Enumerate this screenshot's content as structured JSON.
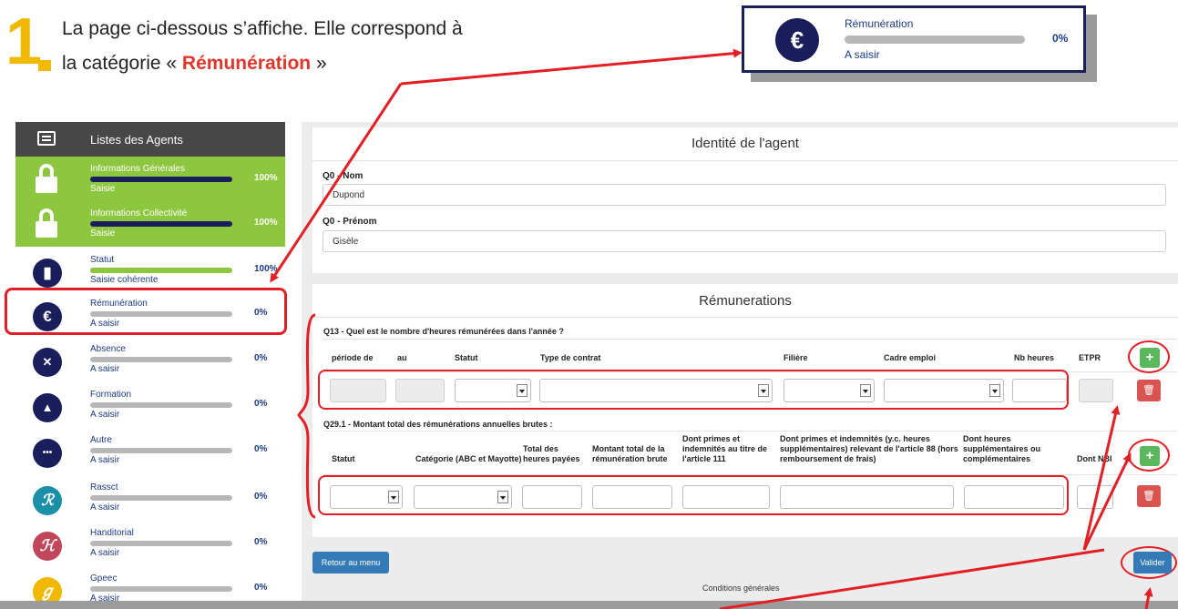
{
  "intro": {
    "step_number": "1",
    "line1": "La page ci-dessous s’affiche. Elle correspond à",
    "line2_prefix": "la catégorie « ",
    "line2_highlight": "Rémunération",
    "line2_suffix": " »"
  },
  "callout": {
    "icon_symbol": "€",
    "title": "Rémunération",
    "percent": "0%",
    "progress": 0,
    "status": "A saisir"
  },
  "sidebar": {
    "header_label": "Listes des Agents",
    "items": [
      {
        "name": "Informations Générales",
        "percent": "100%",
        "progress": 100,
        "status": "Saisie",
        "icon": "unlock-icon"
      },
      {
        "name": "Informations Collectivité",
        "percent": "100%",
        "progress": 100,
        "status": "Saisie",
        "icon": "unlock-icon"
      },
      {
        "name": "Statut",
        "percent": "100%",
        "progress": 100,
        "status": "Saisie cohérente",
        "icon": "briefcase-icon",
        "symbol": "▮"
      },
      {
        "name": "Rémunération",
        "percent": "0%",
        "progress": 0,
        "status": "A saisir",
        "icon": "euro-icon",
        "symbol": "€"
      },
      {
        "name": "Absence",
        "percent": "0%",
        "progress": 0,
        "status": "A saisir",
        "icon": "user-x-icon",
        "symbol": "✕"
      },
      {
        "name": "Formation",
        "percent": "0%",
        "progress": 0,
        "status": "A saisir",
        "icon": "graduation-cap-icon",
        "symbol": "▲"
      },
      {
        "name": "Autre",
        "percent": "0%",
        "progress": 0,
        "status": "A saisir",
        "icon": "ellipsis-icon",
        "symbol": "•••"
      },
      {
        "name": "Rassct",
        "percent": "0%",
        "progress": 0,
        "status": "A saisir",
        "icon": "letter-r-icon",
        "symbol": "ℛ"
      },
      {
        "name": "Handitorial",
        "percent": "0%",
        "progress": 0,
        "status": "A saisir",
        "icon": "letter-h-icon",
        "symbol": "ℋ"
      },
      {
        "name": "Gpeec",
        "percent": "0%",
        "progress": 0,
        "status": "A saisir",
        "icon": "letter-g-icon",
        "symbol": "ℊ"
      }
    ],
    "colors": {
      "dark_navy": "#1a1f5c",
      "green": "#8dc63f",
      "rassct": "#1b8fa8",
      "handitorial": "#c0475a",
      "gpeec": "#f0b800"
    }
  },
  "identity": {
    "title": "Identité de l'agent",
    "nom_label": "Q0 - Nom",
    "nom_value": "Dupond",
    "prenom_label": "Q0 - Prénom",
    "prenom_value": "Gisèle"
  },
  "remunerations": {
    "title": "Rémunerations",
    "q13_label": "Q13 - Quel est le nombre d'heures rémunérées dans l'année ?",
    "q13_headers": [
      "période de",
      "au",
      "Statut",
      "Type de contrat",
      "Filière",
      "Cadre emploi",
      "Nb heures",
      "ETPR"
    ],
    "q29_label": "Q29.1 - Montant total des rémunérations annuelles brutes :",
    "q29_headers": [
      "Statut",
      "Catégorie (ABC et Mayotte)",
      "Total des heures payées",
      "Montant total de la rémunération brute",
      "Dont primes et indemnités au titre de l'article 111",
      "Dont primes et indemnités (y.c. heures supplémentaires) relevant de l'article 88 (hors remboursement de frais)",
      "Dont heures supplémentaires ou complémentaires",
      "Dont NBI"
    ],
    "add_label": "+",
    "delete_label": "🗑"
  },
  "actions": {
    "back_label": "Retour au menu",
    "validate_label": "Valider"
  },
  "footer": {
    "conditions": "Conditions générales"
  }
}
